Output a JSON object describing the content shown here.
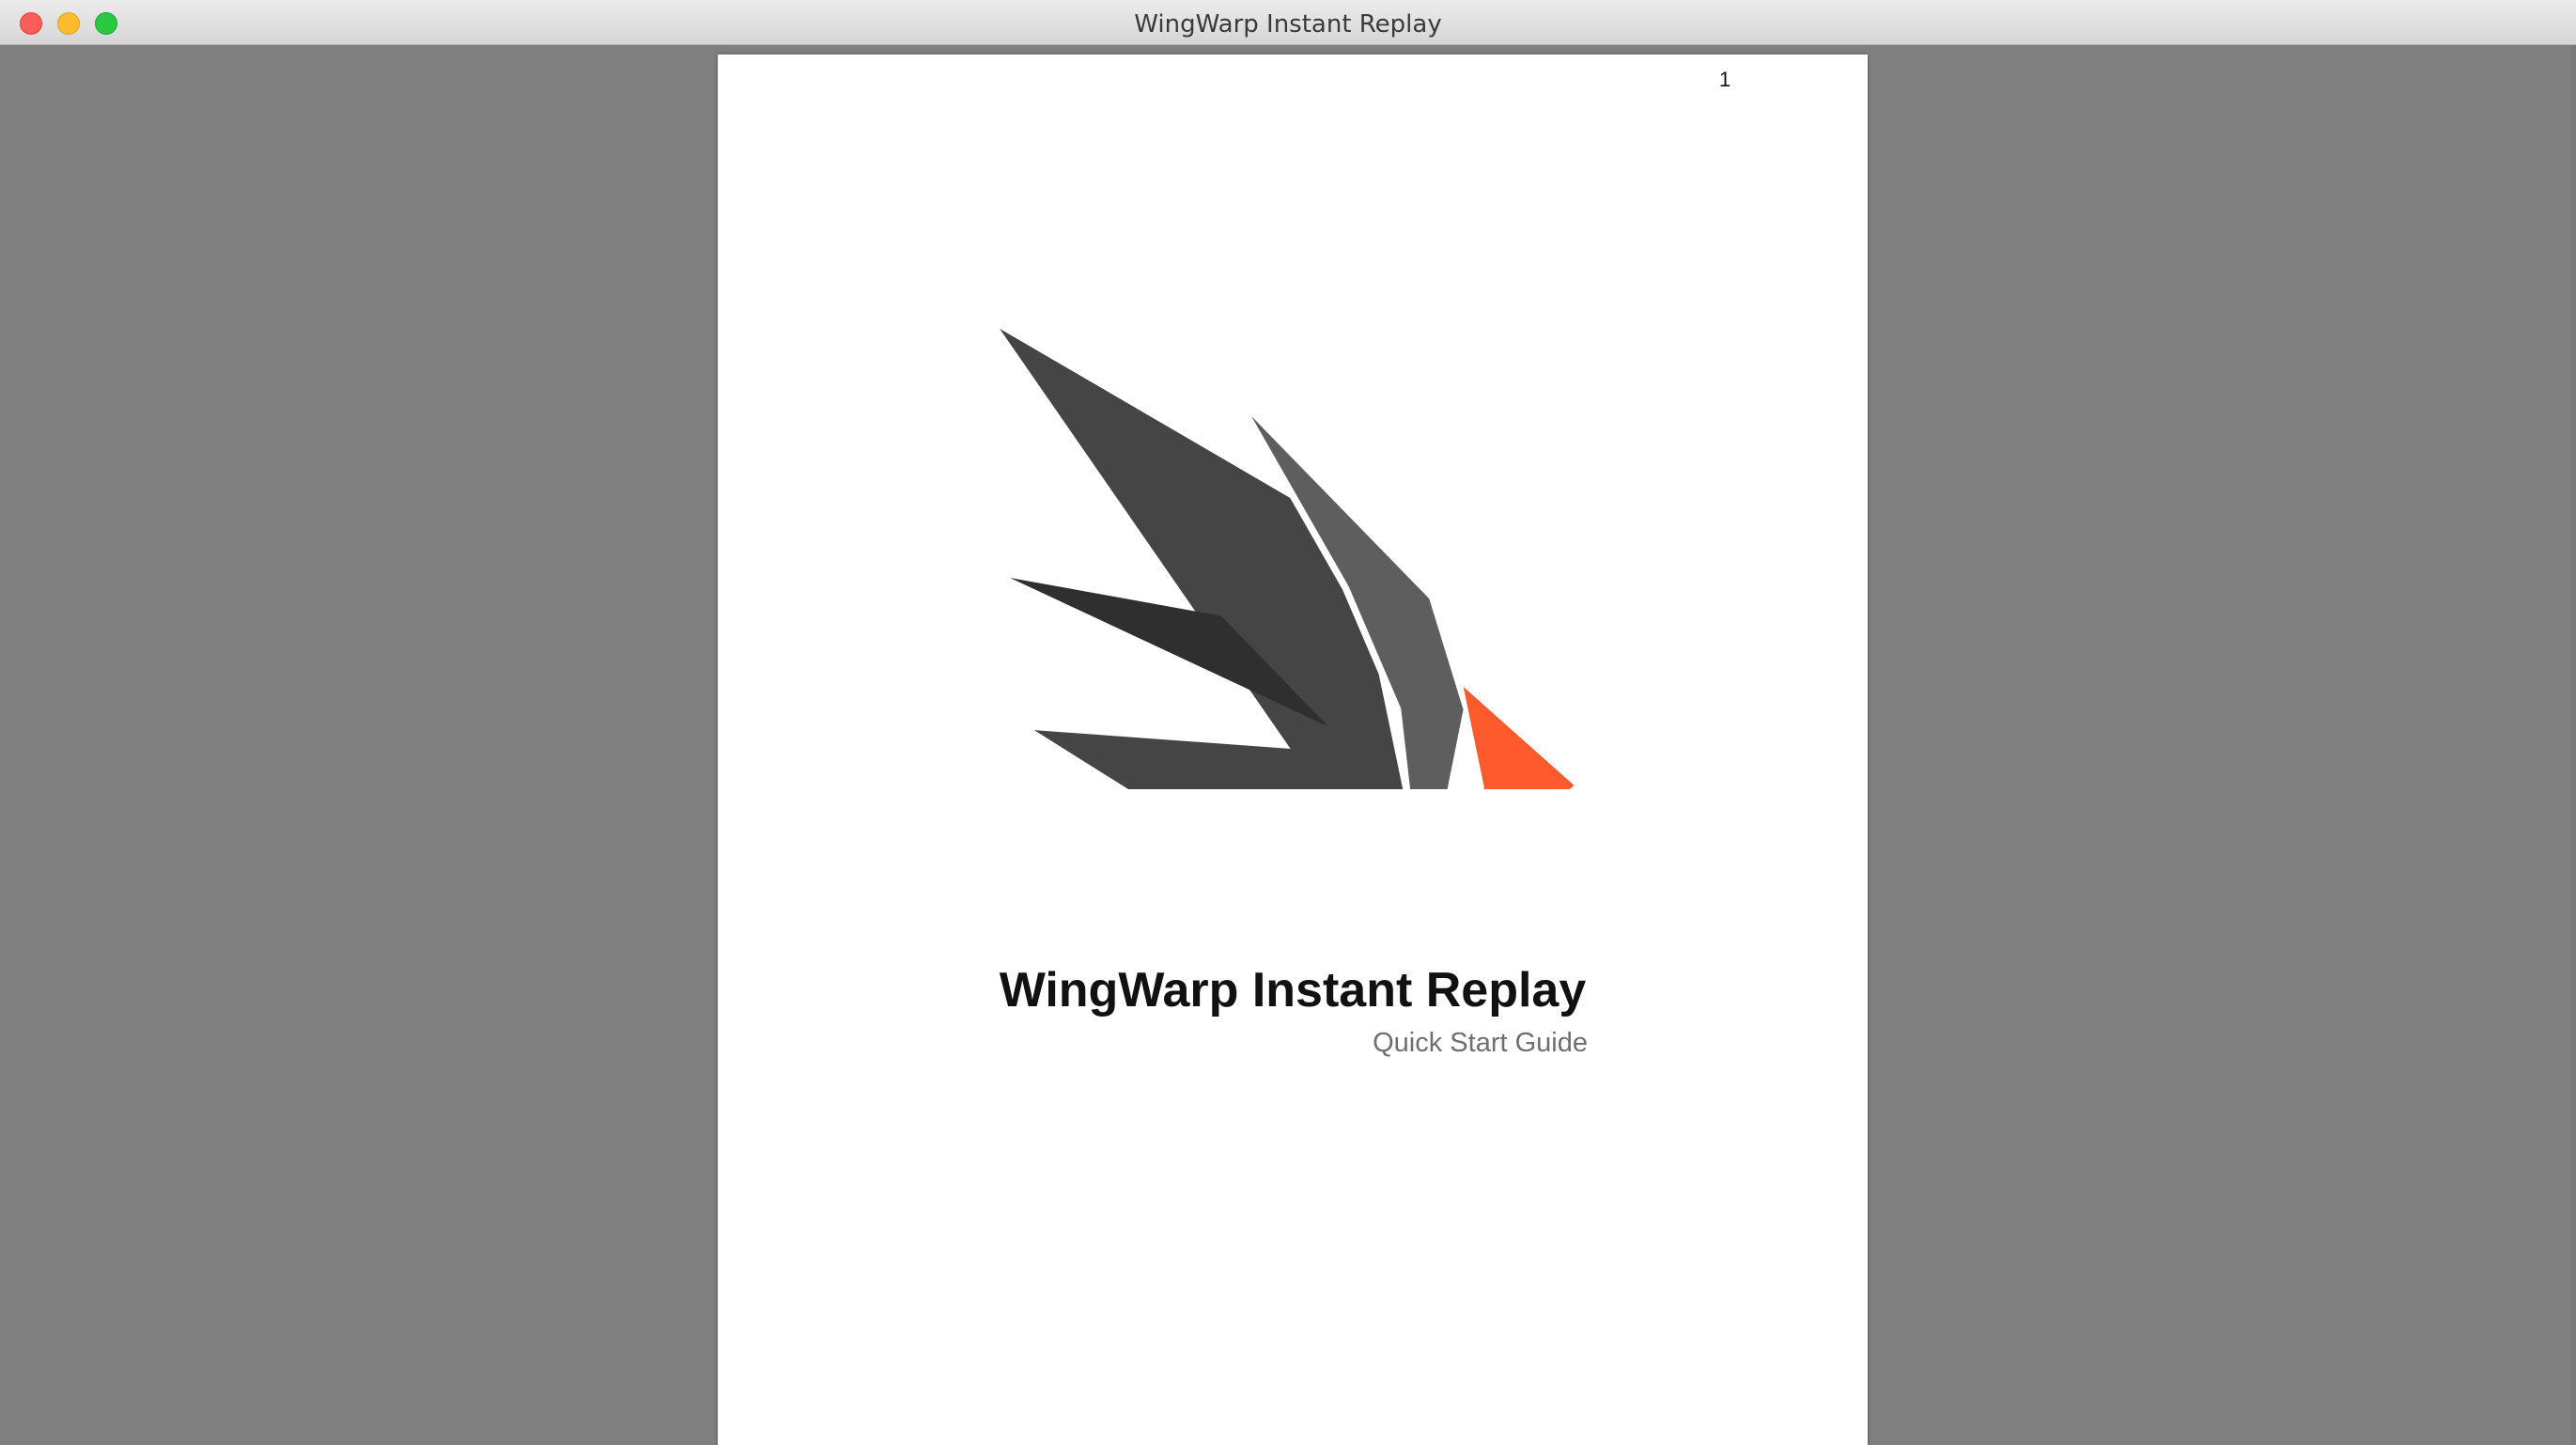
{
  "window": {
    "title": "WingWarp Instant Replay"
  },
  "document": {
    "page_number": "1",
    "title": "WingWarp Instant Replay",
    "subtitle": "Quick Start Guide",
    "logo": {
      "icon": "wing-logo-icon",
      "colors": {
        "dark": "#2f2f2f",
        "medium": "#454545",
        "light": "#5e5e5e",
        "accent": "#ff5a2e"
      }
    }
  },
  "colors": {
    "desktop_background": "#808080",
    "page_background": "#ffffff",
    "close": "#fc5f57",
    "minimize": "#fdbc2e",
    "maximize": "#28c840"
  }
}
